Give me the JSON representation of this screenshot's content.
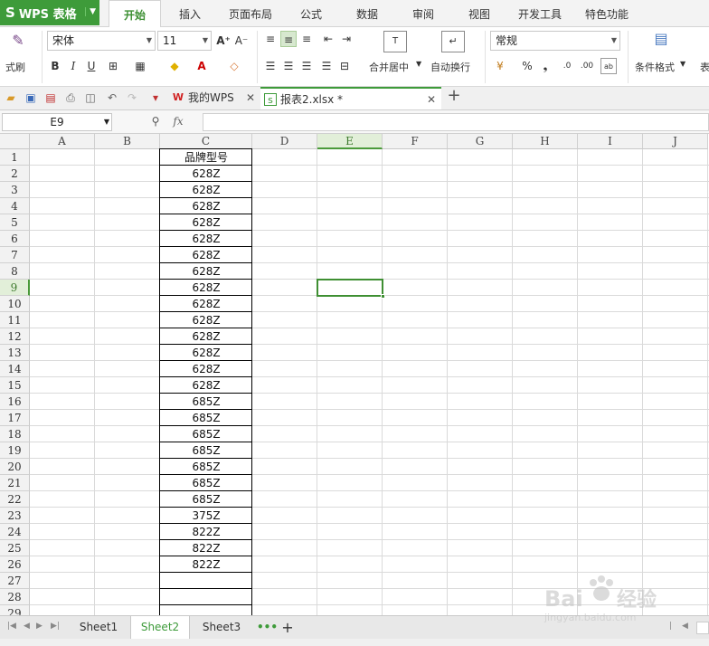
{
  "app": {
    "name": "WPS 表格",
    "logo": "S"
  },
  "menu": [
    "开始",
    "插入",
    "页面布局",
    "公式",
    "数据",
    "审阅",
    "视图",
    "开发工具",
    "特色功能"
  ],
  "ribbon": {
    "format_painter_label": "式刷",
    "font_name": "宋体",
    "font_size": "11",
    "merge_center_label": "合并居中",
    "wrap_text_label": "自动换行",
    "number_format": "常规",
    "conditional_format_label": "条件格式",
    "table_style_label": "表",
    "bold": "B",
    "italic": "I",
    "underline": "U",
    "percent": "%",
    "comma": "❟",
    "grow_font": "A⁺",
    "shrink_font": "A⁻"
  },
  "doc_tabs": [
    {
      "label": "我的WPS",
      "active": false
    },
    {
      "label": "报表2.xlsx *",
      "active": true
    }
  ],
  "formula_bar": {
    "name_box": "E9",
    "fx": "fx",
    "value": ""
  },
  "grid": {
    "columns": [
      "A",
      "B",
      "C",
      "D",
      "E",
      "F",
      "G",
      "H",
      "I",
      "J"
    ],
    "selected_column": "E",
    "rows": [
      "1",
      "2",
      "3",
      "4",
      "5",
      "6",
      "7",
      "8",
      "9",
      "10",
      "11",
      "12",
      "13",
      "14",
      "15",
      "16",
      "17",
      "18",
      "19",
      "20",
      "21",
      "22",
      "23",
      "24",
      "25",
      "26",
      "27",
      "28",
      "29"
    ],
    "selected_row": "9",
    "active_cell": "E9",
    "column_c_values": [
      "品牌型号",
      "628Z",
      "628Z",
      "628Z",
      "628Z",
      "628Z",
      "628Z",
      "628Z",
      "628Z",
      "628Z",
      "628Z",
      "628Z",
      "628Z",
      "628Z",
      "628Z",
      "685Z",
      "685Z",
      "685Z",
      "685Z",
      "685Z",
      "685Z",
      "685Z",
      "375Z",
      "822Z",
      "822Z",
      "822Z",
      "",
      ""
    ]
  },
  "sheets": [
    {
      "label": "Sheet1",
      "active": false
    },
    {
      "label": "Sheet2",
      "active": true
    },
    {
      "label": "Sheet3",
      "active": false
    }
  ],
  "sheet_more": "•••",
  "sheet_add": "+",
  "watermark": {
    "text": "Baidu经验",
    "sub": "jingyan.baidu.com"
  },
  "colors": {
    "accent": "#3e9b3a",
    "selection": "#3f8f33",
    "header_bg": "#f2f2f2"
  }
}
